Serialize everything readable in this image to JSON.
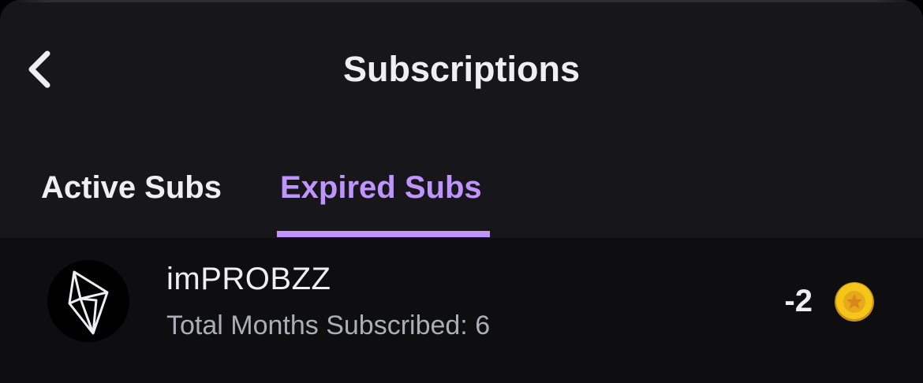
{
  "header": {
    "title": "Subscriptions"
  },
  "tabs": [
    {
      "label": "Active Subs",
      "active": false
    },
    {
      "label": "Expired Subs",
      "active": true
    }
  ],
  "subscriptions": [
    {
      "name": "imPROBZZ",
      "total_months": "Total Months Subscribed: 6",
      "count": "-2"
    }
  ],
  "colors": {
    "background": "#17161b",
    "list_background": "#0e0e10",
    "text_primary": "#efeff1",
    "text_secondary": "#adadb8",
    "accent": "#bf94ff",
    "coin": "#f5c518"
  },
  "icons": {
    "back": "chevron-left-icon",
    "coin": "star-coin-icon",
    "avatar": "gem-logo"
  }
}
